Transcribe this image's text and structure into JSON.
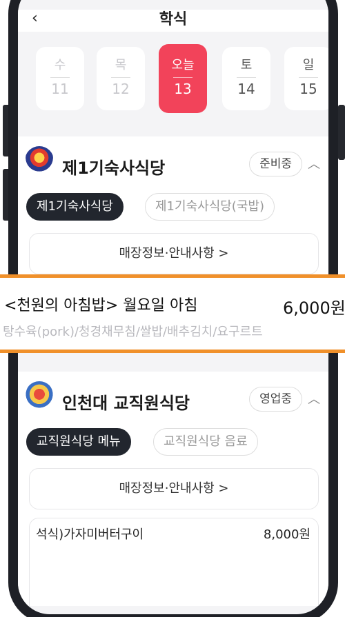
{
  "header": {
    "title": "학식",
    "back_icon": "chevron-left-icon"
  },
  "days": [
    {
      "dow": "수",
      "num": "11",
      "state": "faded"
    },
    {
      "dow": "목",
      "num": "12",
      "state": "faded"
    },
    {
      "dow": "오늘",
      "num": "13",
      "state": "today"
    },
    {
      "dow": "토",
      "num": "14",
      "state": "normal"
    },
    {
      "dow": "일",
      "num": "15",
      "state": "normal"
    }
  ],
  "cafeterias": [
    {
      "name": "제1기숙사식당",
      "status": "준비중",
      "tabs": [
        {
          "label": "제1기숙사식당",
          "active": true
        },
        {
          "label": "제1기숙사식당(국밥)",
          "active": false
        }
      ],
      "store_info": "매장정보·안내사항 >"
    },
    {
      "name": "인천대 교직원식당",
      "status": "영업중",
      "tabs": [
        {
          "label": "교직원식당 메뉴",
          "active": true
        },
        {
          "label": "교직원식당 음료",
          "active": false
        }
      ],
      "store_info": "매장정보·안내사항 >",
      "menu": [
        {
          "name": "석식)가자미버터구이",
          "price": "8,000원"
        }
      ]
    }
  ],
  "highlighted_menu": {
    "name": "<천원의 아침밥> 월요일 아침",
    "price": "6,000원",
    "description": "탕수육(pork)/청경채무침/쌀밥/배추김치/요구르트"
  },
  "colors": {
    "accent": "#f2435a",
    "highlight_border": "#f0902a",
    "dark_chip": "#22262e"
  }
}
